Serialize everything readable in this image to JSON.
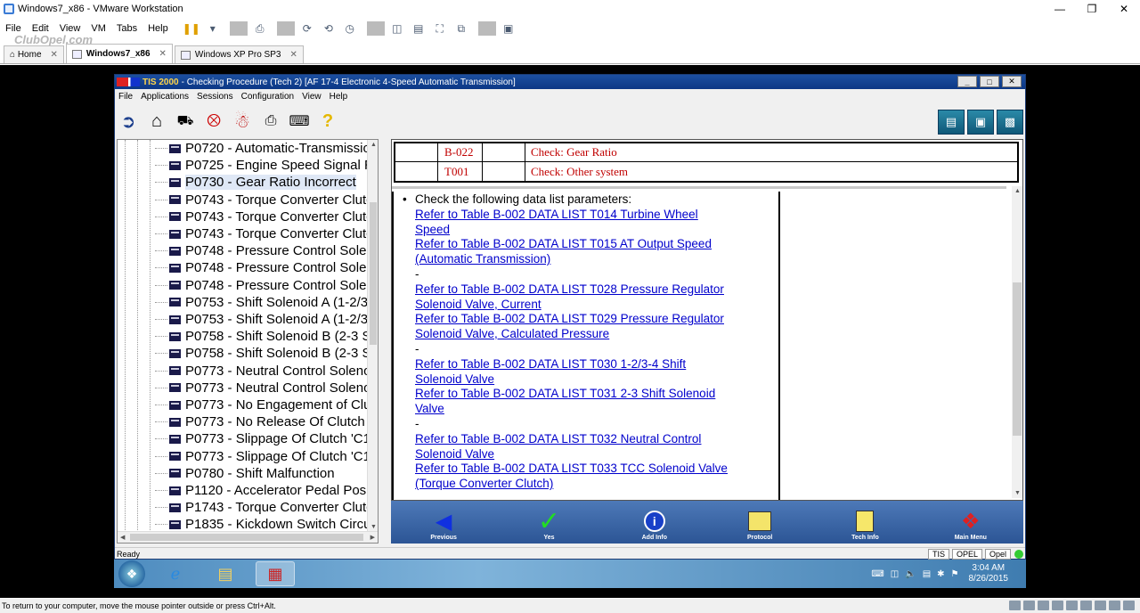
{
  "vmware": {
    "title": "Windows7_x86 - VMware Workstation",
    "menu": [
      "File",
      "Edit",
      "View",
      "VM",
      "Tabs",
      "Help"
    ],
    "tabs": [
      {
        "label": "Home",
        "active": false
      },
      {
        "label": "Windows7_x86",
        "active": true
      },
      {
        "label": "Windows XP Pro SP3",
        "active": false
      }
    ],
    "watermark": "ClubOpel.com",
    "status": "To return to your computer, move the mouse pointer outside or press Ctrl+Alt."
  },
  "tis": {
    "app_name": "TIS 2000",
    "title_rest": "- Checking Procedure (Tech 2) [AF 17-4 Electronic 4-Speed Automatic Transmission]",
    "menu": [
      "File",
      "Applications",
      "Sessions",
      "Configuration",
      "View",
      "Help"
    ],
    "tree_items": [
      "P0720 - Automatic-Transmissio",
      "P0725 - Engine Speed Signal R",
      "P0730 - Gear Ratio Incorrect",
      "P0743 - Torque Converter Clutc",
      "P0743 - Torque Converter Clutc",
      "P0743 - Torque Converter Clutc",
      "P0748 - Pressure Control Soler",
      "P0748 - Pressure Control Soler",
      "P0748 - Pressure Control Soler",
      "P0753 - Shift Solenoid A (1-2/3-",
      "P0753 - Shift Solenoid A (1-2/3-",
      "P0758 - Shift Solenoid B (2-3 S",
      "P0758 - Shift Solenoid B (2-3 S",
      "P0773 - Neutral Control Solenoi",
      "P0773 - Neutral Control Solenoi",
      "P0773 - No Engagement of Clut",
      "P0773 - No Release Of Clutch '",
      "P0773 - Slippage Of Clutch 'C1",
      "P0773 - Slippage Of Clutch 'C1",
      "P0780 - Shift Malfunction",
      "P1120 - Accelerator Pedal Posi",
      "P1743 - Torque Converter Clutc",
      "P1835 - Kickdown Switch Circui"
    ],
    "selected_item": "P0730 - Gear Ratio Incorrect",
    "check_table": [
      {
        "code": "B-022",
        "text": "Check: Gear Ratio"
      },
      {
        "code": "T001",
        "text": "Check: Other system"
      }
    ],
    "bullet_text": "Check the following data list parameters:",
    "links": [
      [
        "Refer to Table B-002 DATA LIST T014 Turbine Wheel",
        "Speed"
      ],
      [
        "Refer to Table B-002 DATA LIST T015 AT Output Speed",
        "(Automatic Transmission)"
      ],
      "-",
      [
        "Refer to Table B-002 DATA LIST T028 Pressure Regulator",
        "Solenoid Valve, Current"
      ],
      [
        "Refer to Table B-002 DATA LIST T029 Pressure Regulator",
        "Solenoid Valve, Calculated Pressure"
      ],
      "-",
      [
        "Refer to Table B-002 DATA LIST T030 1-2/3-4 Shift",
        "Solenoid Valve"
      ],
      [
        "Refer to Table B-002 DATA LIST T031 2-3 Shift Solenoid",
        "Valve"
      ],
      "-",
      [
        "Refer to Table B-002 DATA LIST T032 Neutral Control",
        "Solenoid Valve"
      ],
      [
        "Refer to Table B-002 DATA LIST T033 TCC Solenoid Valve",
        "(Torque Converter Clutch)"
      ]
    ],
    "nav_buttons": [
      "Previous",
      "Yes",
      "Add Info",
      "Protocol",
      "Tech Info",
      "Main Menu"
    ],
    "status": "Ready",
    "status_boxes": [
      "TIS",
      "OPEL",
      "Opel"
    ]
  },
  "taskbar": {
    "time": "3:04 AM",
    "date": "8/26/2015"
  },
  "colors": {
    "link": "#0000cc",
    "check_text": "#c00000",
    "nav_bg": "#3a67a8",
    "title_bar": "#1c4fa0"
  }
}
